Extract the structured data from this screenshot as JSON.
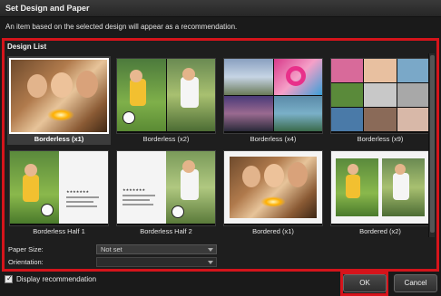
{
  "window": {
    "title": "Set Design and Paper"
  },
  "description": "An item based on the selected design will appear as a recommendation.",
  "design_list": {
    "title": "Design List",
    "items": [
      {
        "label": "Borderless (x1)",
        "selected": true
      },
      {
        "label": "Borderless (x2)",
        "selected": false
      },
      {
        "label": "Borderless (x4)",
        "selected": false
      },
      {
        "label": "Borderless (x9)",
        "selected": false
      },
      {
        "label": "Borderless Half 1",
        "selected": false
      },
      {
        "label": "Borderless Half 2",
        "selected": false
      },
      {
        "label": "Bordered (x1)",
        "selected": false
      },
      {
        "label": "Bordered (x2)",
        "selected": false
      }
    ]
  },
  "paper_size": {
    "label": "Paper Size:",
    "value": "Not set"
  },
  "orientation": {
    "label": "Orientation:",
    "value": ""
  },
  "display_recommendation": {
    "label": "Display recommendation",
    "checked": true
  },
  "buttons": {
    "ok": "OK",
    "cancel": "Cancel"
  },
  "colors": {
    "highlight": "#d5141b",
    "background": "#1e1e1e"
  }
}
